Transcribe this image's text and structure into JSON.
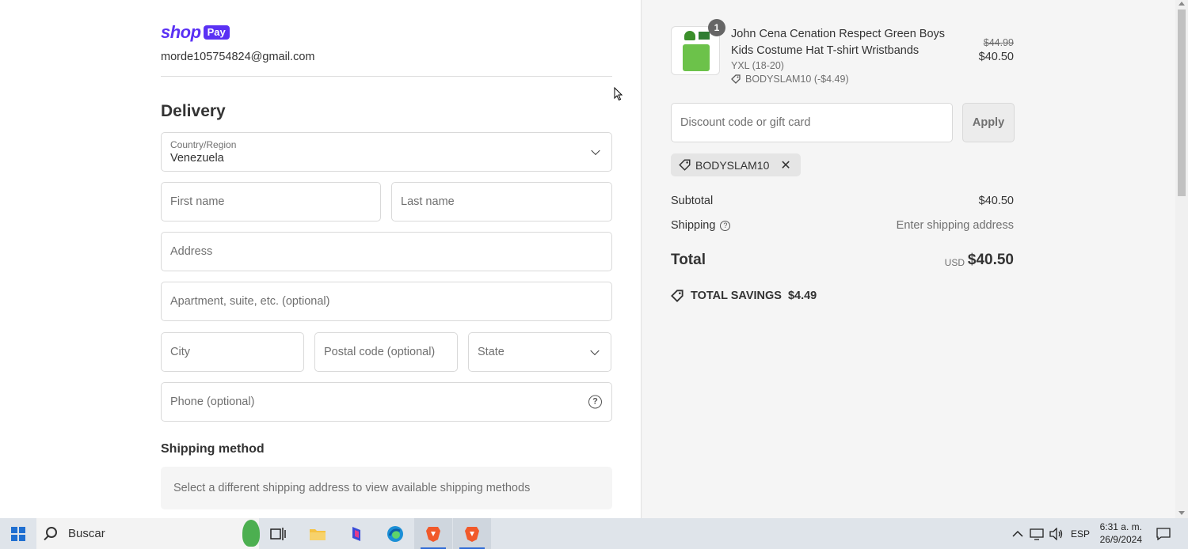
{
  "checkout": {
    "shop_pay": {
      "shop": "shop",
      "pay": "Pay"
    },
    "email": "morde105754824@gmail.com",
    "delivery": {
      "title": "Delivery",
      "country_label": "Country/Region",
      "country_value": "Venezuela",
      "first_name_placeholder": "First name",
      "last_name_placeholder": "Last name",
      "address_placeholder": "Address",
      "apartment_placeholder": "Apartment, suite, etc. (optional)",
      "city_placeholder": "City",
      "postal_placeholder": "Postal code (optional)",
      "state_placeholder": "State",
      "phone_placeholder": "Phone (optional)"
    },
    "shipping_method": {
      "title": "Shipping method",
      "message": "Select a different shipping address to view available shipping methods"
    }
  },
  "summary": {
    "product": {
      "quantity": "1",
      "title": "John Cena Cenation Respect Green Boys Kids Costume Hat T-shirt Wristbands",
      "variant": "YXL (18-20)",
      "discount": "BODYSLAM10 (-$4.49)",
      "original_price": "$44.99",
      "price": "$40.50"
    },
    "discount_placeholder": "Discount code or gift card",
    "apply_label": "Apply",
    "applied_code": "BODYSLAM10",
    "subtotal_label": "Subtotal",
    "subtotal_value": "$40.50",
    "shipping_label": "Shipping",
    "shipping_value": "Enter shipping address",
    "total_label": "Total",
    "currency": "USD",
    "total_value": "$40.50",
    "savings_label": "TOTAL SAVINGS",
    "savings_value": "$4.49"
  },
  "taskbar": {
    "search_label": "Buscar",
    "language": "ESP",
    "time": "6:31 a. m.",
    "date": "26/9/2024"
  },
  "colors": {
    "shop_pay_purple": "#5a31f4",
    "summary_background": "#f5f5f5"
  }
}
